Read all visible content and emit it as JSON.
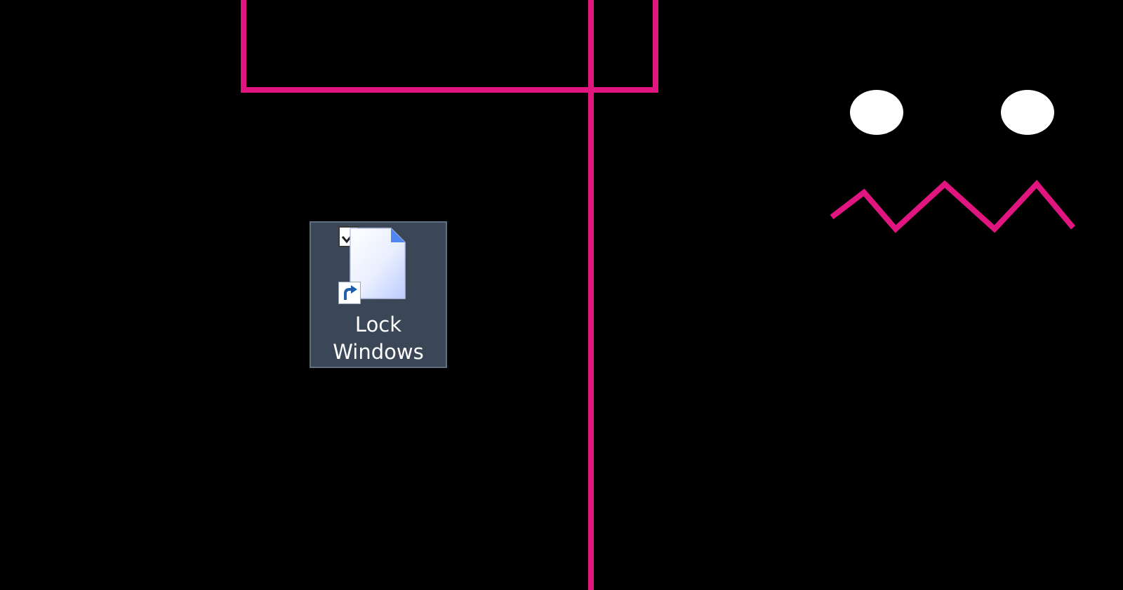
{
  "colors": {
    "wallpaper_background": "#000000",
    "wallpaper_accent": "#e0157f",
    "wallpaper_eyes": "#ffffff",
    "icon_selection_fill": "#3b4756",
    "icon_selection_border": "#5e6f84",
    "shortcut_arrow": "#1f5fae"
  },
  "desktop": {
    "icons": [
      {
        "label_line1": "Lock",
        "label_line2": "Windows",
        "icon": "document-file-icon",
        "overlay": "shortcut-arrow-icon",
        "checkbox_checked": true,
        "selected": true
      }
    ]
  }
}
